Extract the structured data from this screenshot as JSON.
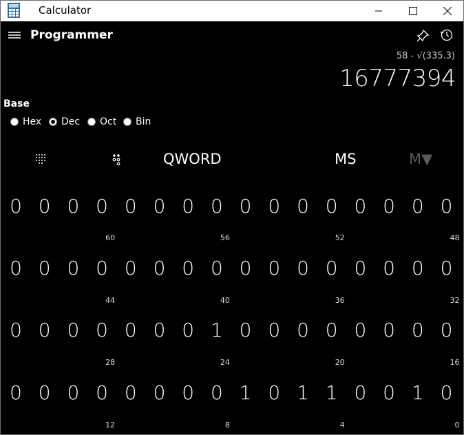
{
  "window": {
    "title": "Calculator"
  },
  "header": {
    "mode": "Programmer"
  },
  "display": {
    "expression": "58 - √(335.3)",
    "result": "16777394"
  },
  "base": {
    "label": "Base",
    "options": [
      {
        "label": "Hex",
        "checked": false
      },
      {
        "label": "Dec",
        "checked": true
      },
      {
        "label": "Oct",
        "checked": false
      },
      {
        "label": "Bin",
        "checked": false
      }
    ]
  },
  "toolbar": {
    "word_size": "QWORD",
    "memory_store": "MS",
    "memory_list": "M▼"
  },
  "bits": {
    "rows": [
      [
        "0",
        "0",
        "0",
        "0",
        "0",
        "0",
        "0",
        "0",
        "0",
        "0",
        "0",
        "0",
        "0",
        "0",
        "0",
        "0"
      ],
      [
        "0",
        "0",
        "0",
        "0",
        "0",
        "0",
        "0",
        "0",
        "0",
        "0",
        "0",
        "0",
        "0",
        "0",
        "0",
        "0"
      ],
      [
        "0",
        "0",
        "0",
        "0",
        "0",
        "0",
        "0",
        "1",
        "0",
        "0",
        "0",
        "0",
        "0",
        "0",
        "0",
        "0"
      ],
      [
        "0",
        "0",
        "0",
        "0",
        "0",
        "0",
        "0",
        "0",
        "1",
        "0",
        "1",
        "1",
        "0",
        "0",
        "1",
        "0"
      ]
    ],
    "indices": [
      [
        "60",
        "56",
        "52",
        "48"
      ],
      [
        "44",
        "40",
        "36",
        "32"
      ],
      [
        "28",
        "24",
        "20",
        "16"
      ],
      [
        "12",
        "8",
        "4",
        "0"
      ]
    ]
  }
}
